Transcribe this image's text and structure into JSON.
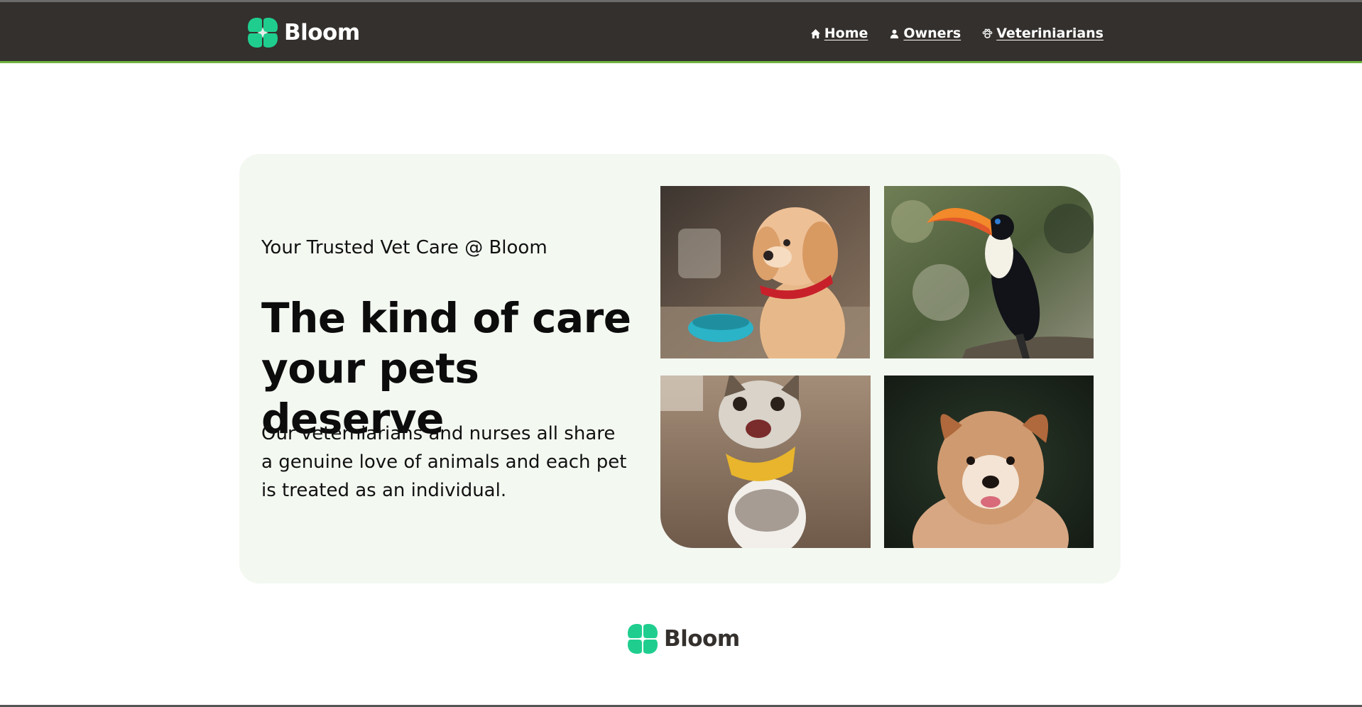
{
  "brand": {
    "name": "Bloom",
    "logo_color": "#1fce8f"
  },
  "nav": {
    "items": [
      {
        "label": "Home",
        "icon": "home-icon"
      },
      {
        "label": "Owners",
        "icon": "person-icon"
      },
      {
        "label": "Veteriniarians",
        "icon": "paw-icon"
      }
    ],
    "background": "#34302d",
    "accent": "#6db33f"
  },
  "hero": {
    "eyebrow": "Your Trusted Vet Care @ Bloom",
    "headline_line1": "The kind of care",
    "headline_line2": "your pets deserve",
    "description": "Our veterniarians and nurses all share a genuine love of animals and each pet is treated as an individual.",
    "background": "#f3f8f1",
    "images": [
      {
        "subject": "golden puppy with red collar"
      },
      {
        "subject": "toucan on branch"
      },
      {
        "subject": "smiling cat with yellow bandana"
      },
      {
        "subject": "fluffy brown puppy"
      }
    ]
  },
  "footer": {
    "brand_name": "Bloom"
  }
}
